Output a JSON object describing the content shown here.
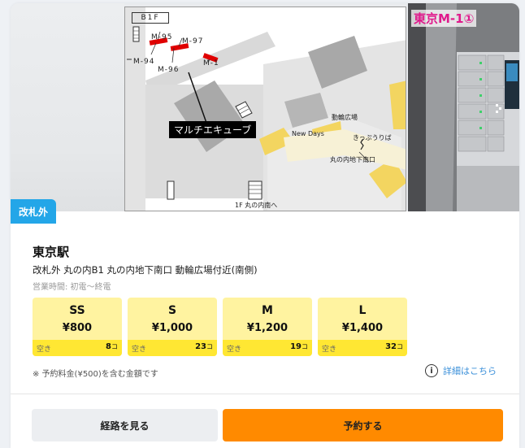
{
  "photo": {
    "map": {
      "floor_label": "B1F",
      "locker_labels": [
        "M-95",
        "M-97",
        "M-94",
        "M-1",
        "M-96"
      ],
      "callout": "マルチエキューブ",
      "new_days": "New Days",
      "ticket_gate": "きっぷうりば",
      "plaza": "動輪広場",
      "exit": "丸の内地下南口",
      "stairs": "1F 丸の内南へ"
    },
    "caption": "東京M-1①"
  },
  "badge": "改札外",
  "station": {
    "name": "東京駅",
    "location": "改札外 丸の内B1 丸の内地下南口 動輪広場付近(南側)",
    "hours": "営業時間: 初電〜終電"
  },
  "sizes": [
    {
      "label": "SS",
      "price": "¥800",
      "avail_label": "空き",
      "count": "8",
      "unit": "コ"
    },
    {
      "label": "S",
      "price": "¥1,000",
      "avail_label": "空き",
      "count": "23",
      "unit": "コ"
    },
    {
      "label": "M",
      "price": "¥1,200",
      "avail_label": "空き",
      "count": "19",
      "unit": "コ"
    },
    {
      "label": "L",
      "price": "¥1,400",
      "avail_label": "空き",
      "count": "32",
      "unit": "コ"
    }
  ],
  "note": "※ 予約料金(¥500)を含む金額です",
  "details": {
    "icon_glyph": "i",
    "link": "詳細はこちら"
  },
  "buttons": {
    "route": "経路を見る",
    "reserve": "予約する"
  },
  "colors": {
    "badge": "#23a6e8",
    "size_box": "#fff3a0",
    "size_foot": "#ffe733",
    "reserve": "#ff8a00",
    "link": "#3a8fd9",
    "caption": "#e01a8c",
    "locker_marker": "#e00000"
  }
}
